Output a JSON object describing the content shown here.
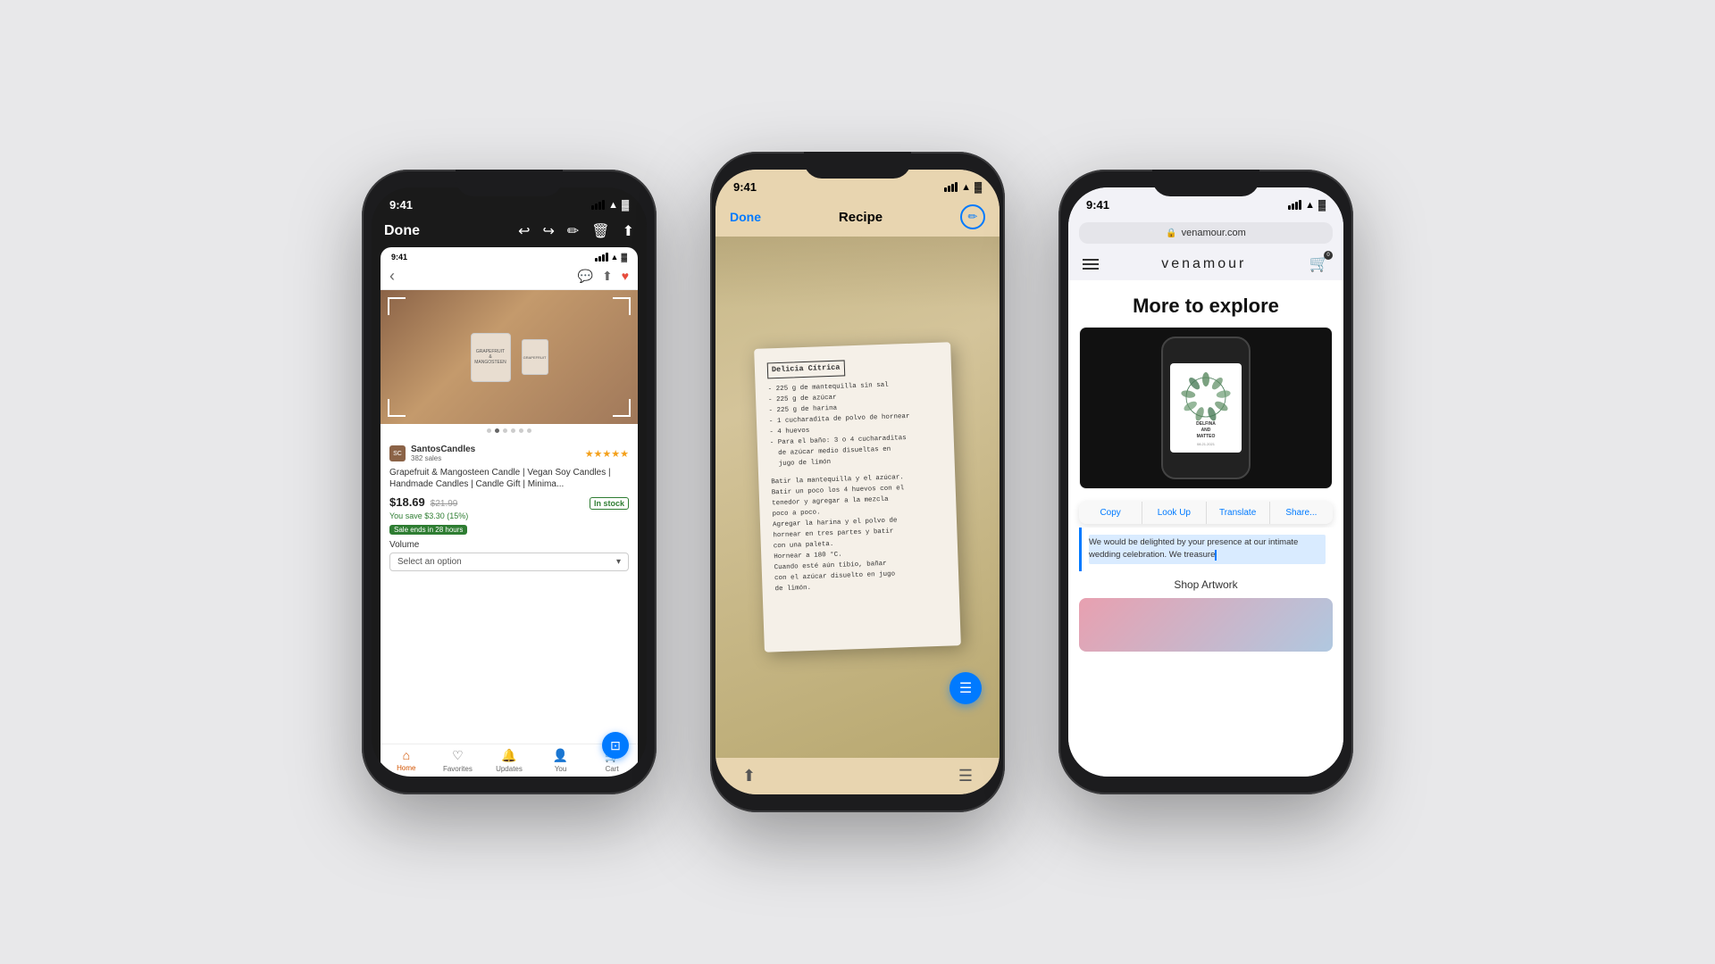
{
  "page": {
    "background_color": "#e8e8ea"
  },
  "phone1": {
    "status": {
      "time": "9:41",
      "signal": "●●●●",
      "wifi": "wifi",
      "battery": "battery"
    },
    "toolbar": {
      "done": "Done",
      "icons": [
        "↩",
        "↪",
        "✎",
        "🗑",
        "↑"
      ]
    },
    "embedded_app": {
      "status_time": "9:41",
      "seller_name": "SantosCandles",
      "seller_sales": "382 sales",
      "product_title": "Grapefruit & Mangosteen Candle | Vegan Soy Candles | Handmade Candles | Candle Gift | Minima...",
      "price_current": "$18.69",
      "price_old": "$21.99",
      "save_text": "You save $3.30 (15%)",
      "sale_badge": "Sale ends in 28 hours",
      "in_stock": "In stock",
      "volume_label": "Volume",
      "select_placeholder": "Select an option",
      "tabs": [
        "Home",
        "Favorites",
        "Updates",
        "You",
        "Cart"
      ]
    }
  },
  "phone2": {
    "status": {
      "time": "9:41"
    },
    "header": {
      "done": "Done",
      "title": "Recipe"
    },
    "recipe": {
      "heading": "Delicia Cítrica",
      "ingredients": [
        "- 225 g de mantequilla sin sal",
        "- 225 g de azúcar",
        "- 225 g de harina",
        "- 1 cucharadita de polvo de hornear",
        "- 4 huevos",
        "- Para el baño: 3 o 4 cucharaditas de azúcar medio disueltas en jugo de limón"
      ],
      "instructions": [
        "Batir la mantequilla y el azúcar.",
        "Batir un poco los 4 huevos con el tenedor y agregar a la mezcla poco a poco.",
        "Agregar la harina y el polvo de hornear en tres partes y batir con una paleta.",
        "Hornear a 180 °C.",
        "Cuando esté aún tibio, bañar con el azúcar disuelto en jugo de limón."
      ]
    }
  },
  "phone3": {
    "status": {
      "time": "9:41"
    },
    "browser": {
      "url": "venamour.com",
      "site_name": "venamour"
    },
    "content": {
      "heading": "More to explore",
      "couple_names": "DELFINA\nAND\nMATTEO",
      "wedding_date": "08.21.2021",
      "context_menu": [
        "Copy",
        "Look Up",
        "Translate",
        "Share..."
      ],
      "selected_text": "We would be delighted by your presence at our intimate wedding celebration. We treasure",
      "shop_label": "Shop Artwork"
    }
  }
}
